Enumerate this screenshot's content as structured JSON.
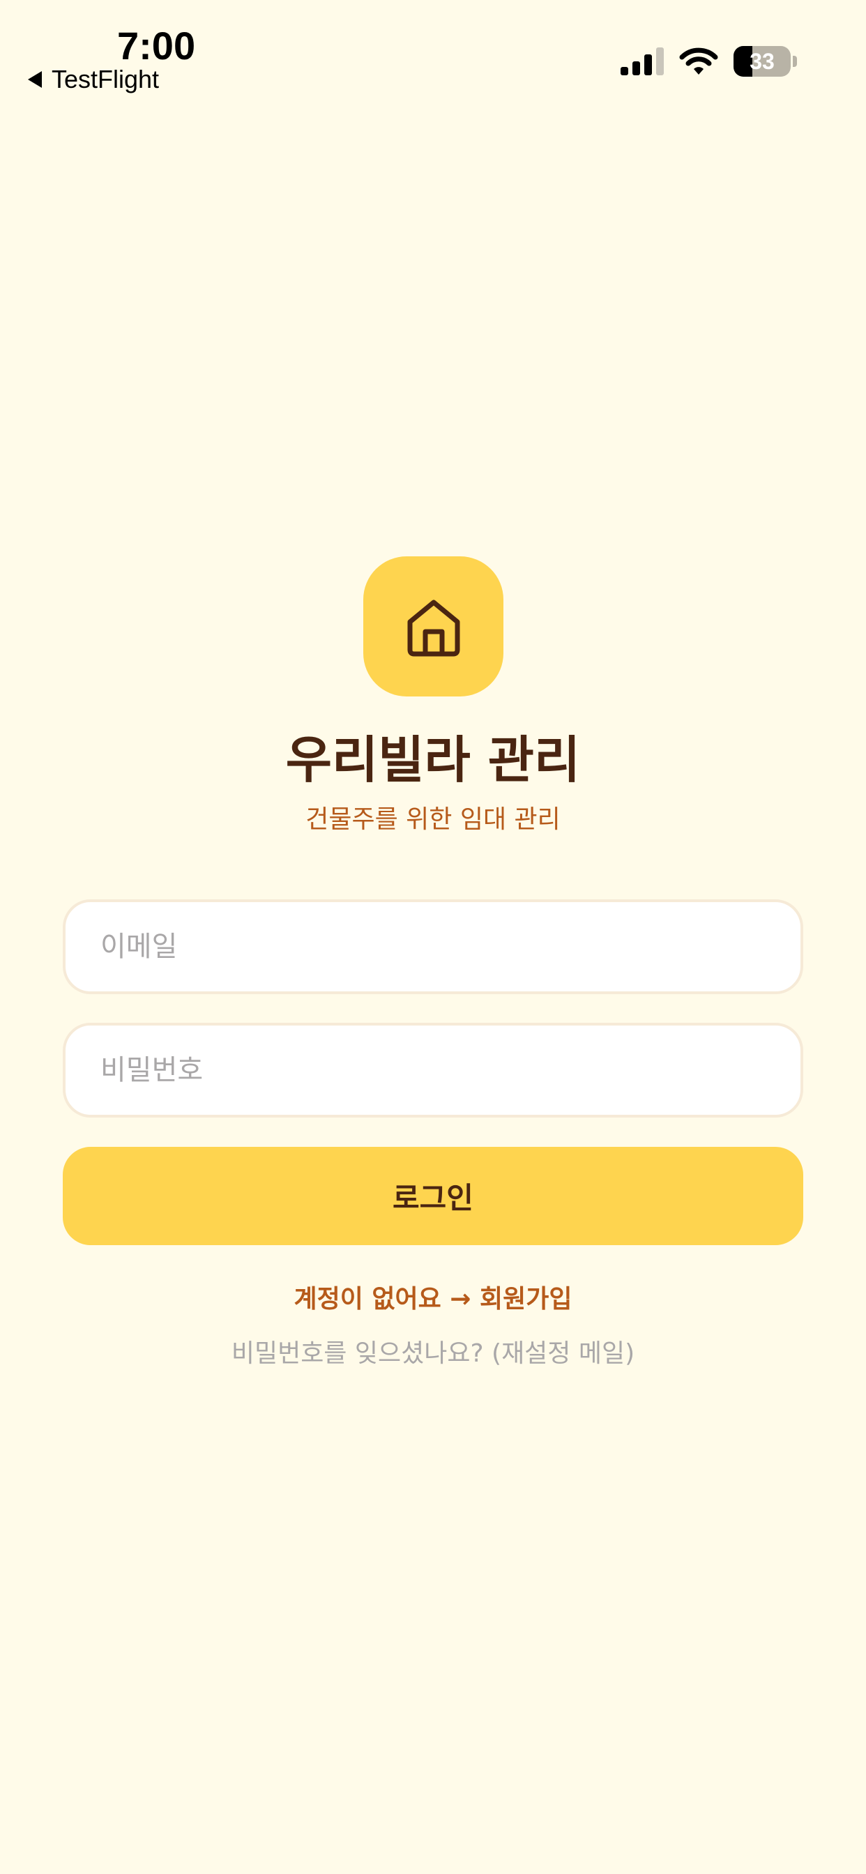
{
  "status_bar": {
    "time": "7:00",
    "back_label": "TestFlight",
    "battery_level": "33",
    "battery_fraction": 0.33,
    "icons": [
      "signal-icon",
      "wifi-icon",
      "battery-icon"
    ]
  },
  "app": {
    "logo_icon": "house-icon",
    "title": "우리빌라 관리",
    "subtitle": "건물주를 위한 임대 관리"
  },
  "login_form": {
    "email_placeholder": "이메일",
    "password_placeholder": "비밀번호",
    "login_label": "로그인"
  },
  "links": {
    "signup": "계정이 없어요 → 회원가입",
    "forgot_password": "비밀번호를 잊으셨나요? (재설정 메일)"
  },
  "colors": {
    "background": "#fffbe9",
    "accent": "#fed44f",
    "title_text": "#4a2511",
    "link_text": "#b65a1a",
    "muted_text": "#a9a7a8"
  }
}
